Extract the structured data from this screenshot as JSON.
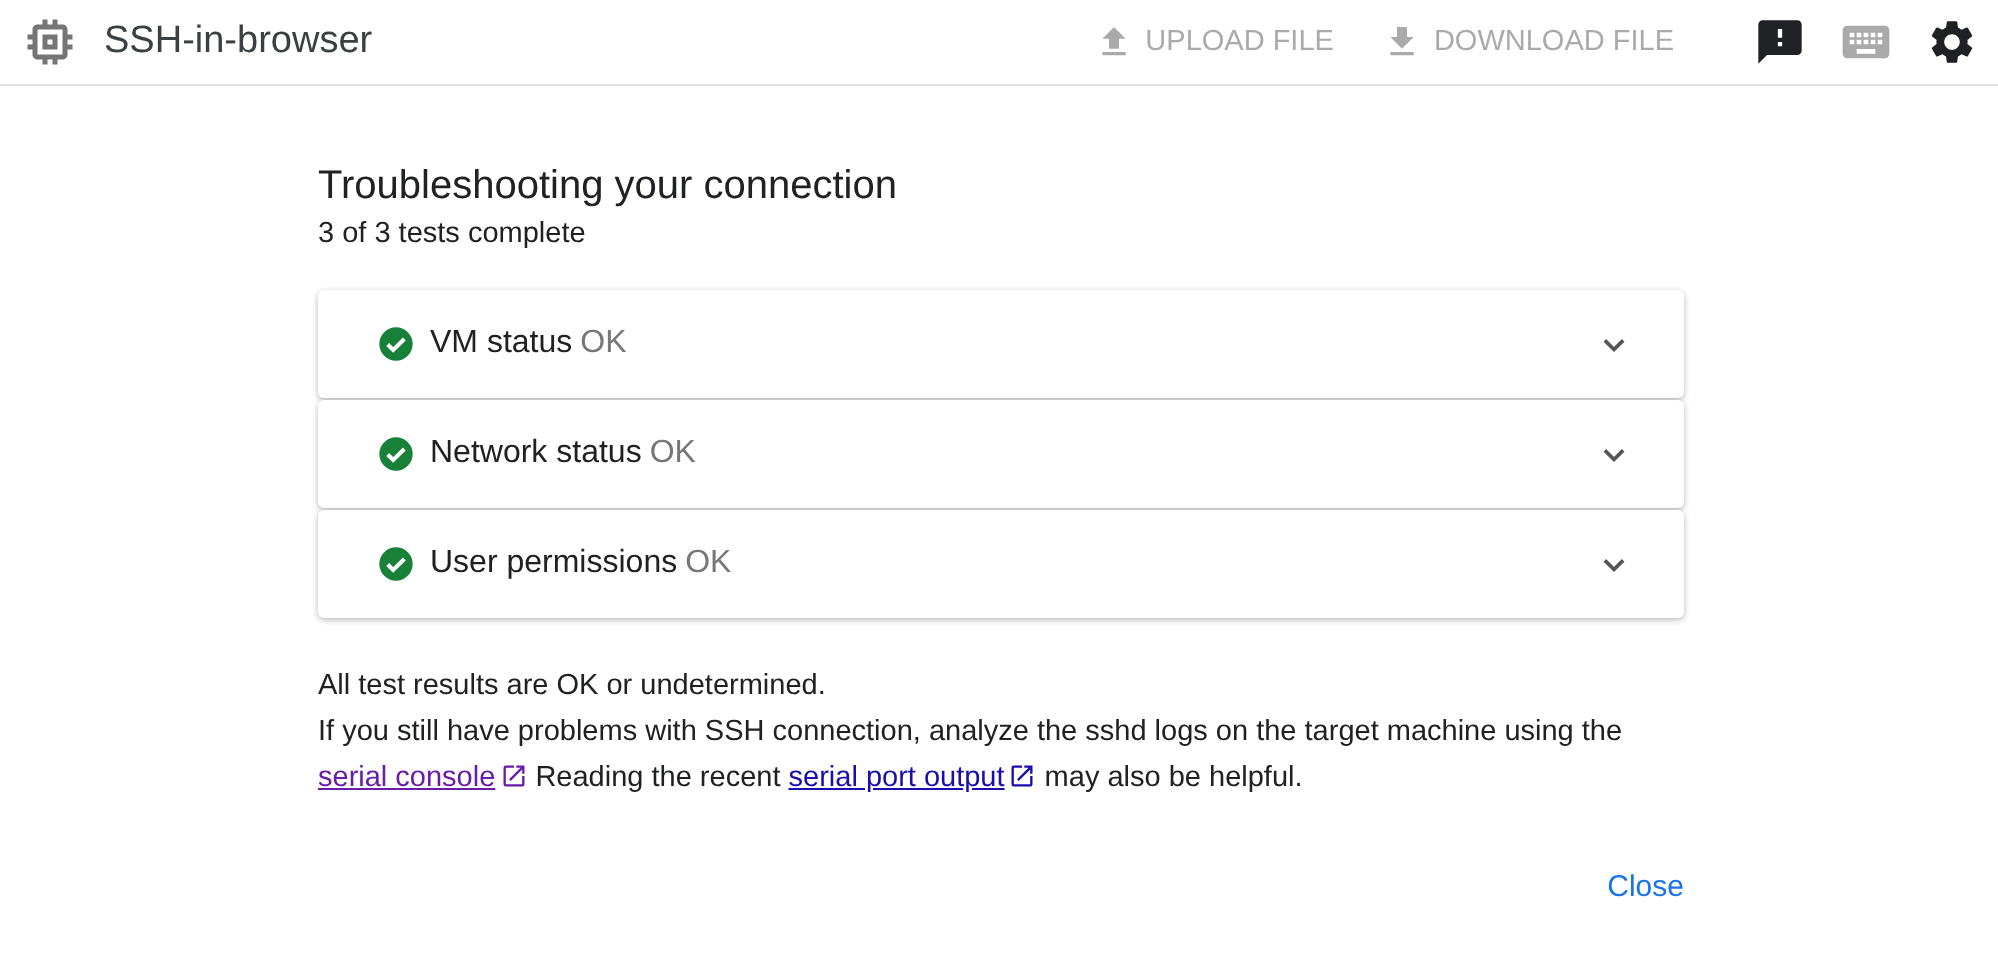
{
  "app": {
    "title": "SSH-in-browser"
  },
  "toolbar": [
    {
      "kind": "upload",
      "label": "UPLOAD FILE",
      "disabled": true
    },
    {
      "kind": "download",
      "label": "DOWNLOAD FILE",
      "disabled": true
    },
    {
      "kind": "feedback",
      "disabled": false
    },
    {
      "kind": "keyboard",
      "disabled": true
    },
    {
      "kind": "settings",
      "disabled": false
    }
  ],
  "dialog": {
    "title": "Troubleshooting your connection",
    "subtitle": "3 of 3 tests complete",
    "tests": [
      {
        "name": "VM status",
        "status": "OK",
        "expanded": false
      },
      {
        "name": "Network status",
        "status": "OK",
        "expanded": false
      },
      {
        "name": "User permissions",
        "status": "OK",
        "expanded": false
      }
    ],
    "summary": "All test results are OK or undetermined.",
    "help": [
      {
        "kind": "text",
        "text": "If you still have problems with SSH connection, analyze the sshd logs on the target machine using the "
      },
      {
        "kind": "link",
        "text": "serial console",
        "visited": true
      },
      {
        "kind": "text",
        "text": " Reading the recent "
      },
      {
        "kind": "link",
        "text": "serial port output",
        "visited": false
      },
      {
        "kind": "text",
        "text": " may also be helpful."
      }
    ],
    "close_button": "Close"
  }
}
